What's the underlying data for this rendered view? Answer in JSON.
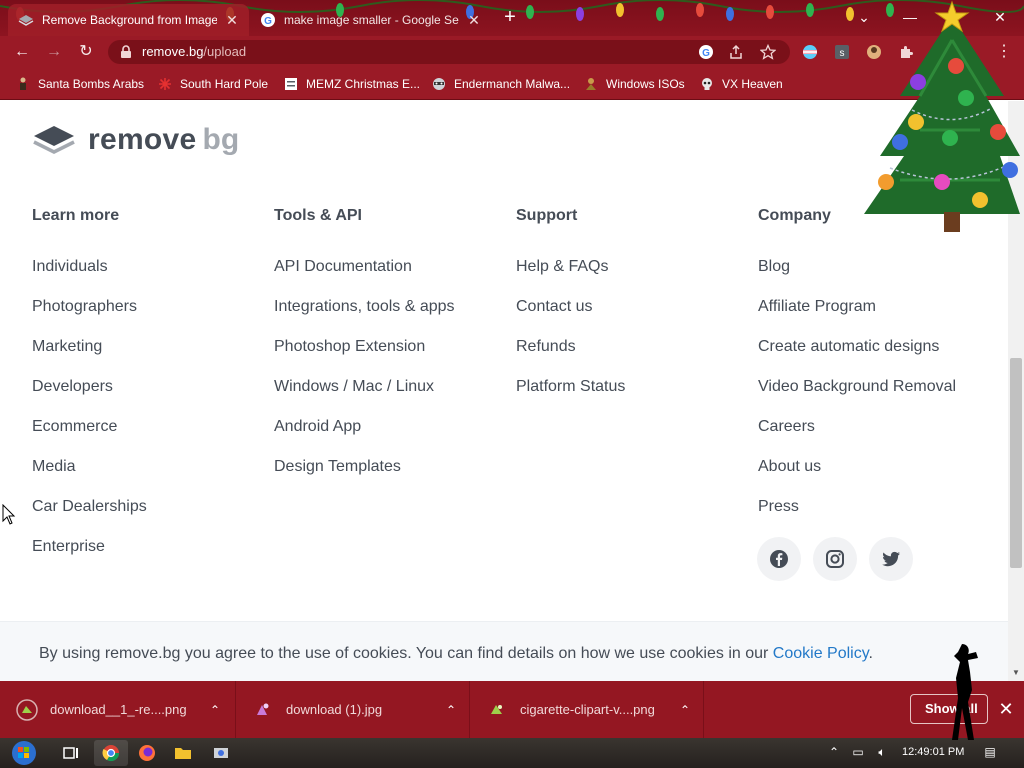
{
  "browser": {
    "tabs": [
      {
        "label": "Remove Background from Image",
        "active": true
      },
      {
        "label": "make image smaller - Google Se",
        "active": false
      }
    ],
    "url": {
      "host": "remove.bg",
      "path": "/upload"
    },
    "bookmarks": [
      {
        "label": "Santa Bombs Arabs"
      },
      {
        "label": "South Hard Pole"
      },
      {
        "label": "MEMZ Christmas E..."
      },
      {
        "label": "Endermanch Malwa..."
      },
      {
        "label": "Windows ISOs"
      },
      {
        "label": "VX Heaven"
      }
    ]
  },
  "page": {
    "logo": {
      "word1": "remove",
      "word2": "bg"
    },
    "columns": [
      {
        "heading": "Learn more",
        "links": [
          "Individuals",
          "Photographers",
          "Marketing",
          "Developers",
          "Ecommerce",
          "Media",
          "Car Dealerships",
          "Enterprise"
        ]
      },
      {
        "heading": "Tools & API",
        "links": [
          "API Documentation",
          "Integrations, tools & apps",
          "Photoshop Extension",
          "Windows / Mac / Linux",
          "Android App",
          "Design Templates"
        ]
      },
      {
        "heading": "Support",
        "links": [
          "Help & FAQs",
          "Contact us",
          "Refunds",
          "Platform Status"
        ]
      },
      {
        "heading": "Company",
        "links": [
          "Blog",
          "Affiliate Program",
          "Create automatic designs",
          "Video Background Removal",
          "Careers",
          "About us",
          "Press"
        ]
      }
    ],
    "social": [
      "facebook-icon",
      "instagram-icon",
      "twitter-icon"
    ],
    "cookie": {
      "text": "By using remove.bg you agree to the use of cookies. You can find details on how we use cookies in our ",
      "link": "Cookie Policy",
      "end": "."
    }
  },
  "downloads": {
    "items": [
      {
        "name": "download__1_-re....png"
      },
      {
        "name": "download (1).jpg"
      },
      {
        "name": "cigarette-clipart-v....png"
      }
    ],
    "show_all": "Show all"
  },
  "taskbar": {
    "time": "12:49:01 PM"
  },
  "colors": {
    "accent": "#9a1a26",
    "link": "#2379c8",
    "text": "#454c56"
  }
}
